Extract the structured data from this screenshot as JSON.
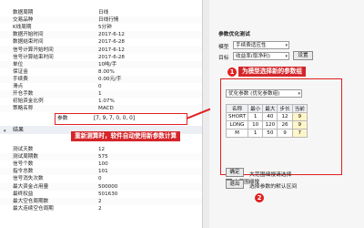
{
  "grid": {
    "rows_top": [
      {
        "k": "数据周期",
        "v": "日线"
      },
      {
        "k": "交易品种",
        "v": "日线行情"
      },
      {
        "k": "K线周期",
        "v": "5分钟"
      },
      {
        "k": "数据开始时间",
        "v": "2017-6-12"
      },
      {
        "k": "数据结束时间",
        "v": "2017-6-28"
      },
      {
        "k": "信号计算开始时间",
        "v": "2017-6-12"
      },
      {
        "k": "信号计算结束时间",
        "v": "2017-6-28"
      },
      {
        "k": "单位",
        "v": "10吨/手"
      },
      {
        "k": "保证金",
        "v": "8.00%"
      },
      {
        "k": "手续费",
        "v": "0.00元/手"
      },
      {
        "k": "滑点",
        "v": "0"
      },
      {
        "k": "开仓手数",
        "v": "1"
      },
      {
        "k": "初始资金比例",
        "v": "1.07%"
      },
      {
        "k": "策略名称",
        "v": "MACD"
      }
    ],
    "params": {
      "k": "参数",
      "v": "[7, 9, 7, 0, 0, 0]"
    },
    "section_label": "结果",
    "rows_bottom": [
      {
        "k": "测试天数",
        "v": "12"
      },
      {
        "k": "测试周期数",
        "v": "575"
      },
      {
        "k": "信号个数",
        "v": "100"
      },
      {
        "k": "指令总数",
        "v": "101"
      },
      {
        "k": "信号消失次数",
        "v": "0"
      },
      {
        "k": "最大资金占用量",
        "v": "500000"
      },
      {
        "k": "最终权益",
        "v": "501630"
      },
      {
        "k": "最大空仓周期数",
        "v": "2"
      },
      {
        "k": "最大连续空仓周期",
        "v": "2"
      }
    ]
  },
  "callouts": {
    "bottom_text": "重新测算时，软件自动使用新参数计算",
    "top_text": "为模型选择新的参数组",
    "top_badge": "1",
    "bottom_badge": "2"
  },
  "right": {
    "section_title": "参数优化测试",
    "model_label": "模型",
    "model_value": "手续费适应性",
    "target_label": "目标",
    "target_value": "收益率(取净利)",
    "settings_button": "设置",
    "param_group_label": "优化参数",
    "param_group_value": "优化参数 (优化参数组)",
    "table_headers": [
      "名称",
      "最小",
      "最大",
      "步长",
      "当前"
    ],
    "table_rows": [
      [
        "SHORT",
        "1",
        "40",
        "12",
        "9"
      ],
      [
        "LONG",
        "10",
        "120",
        "26",
        "9"
      ],
      [
        "M",
        "1",
        "50",
        "9",
        "7"
      ]
    ],
    "checks": [
      "大范围细搜",
      "批量细搜"
    ],
    "ok_button": "确定",
    "cancel_button": "退出",
    "note1": "大范围细搜请选择",
    "note2": "选择参数的默认区间"
  }
}
